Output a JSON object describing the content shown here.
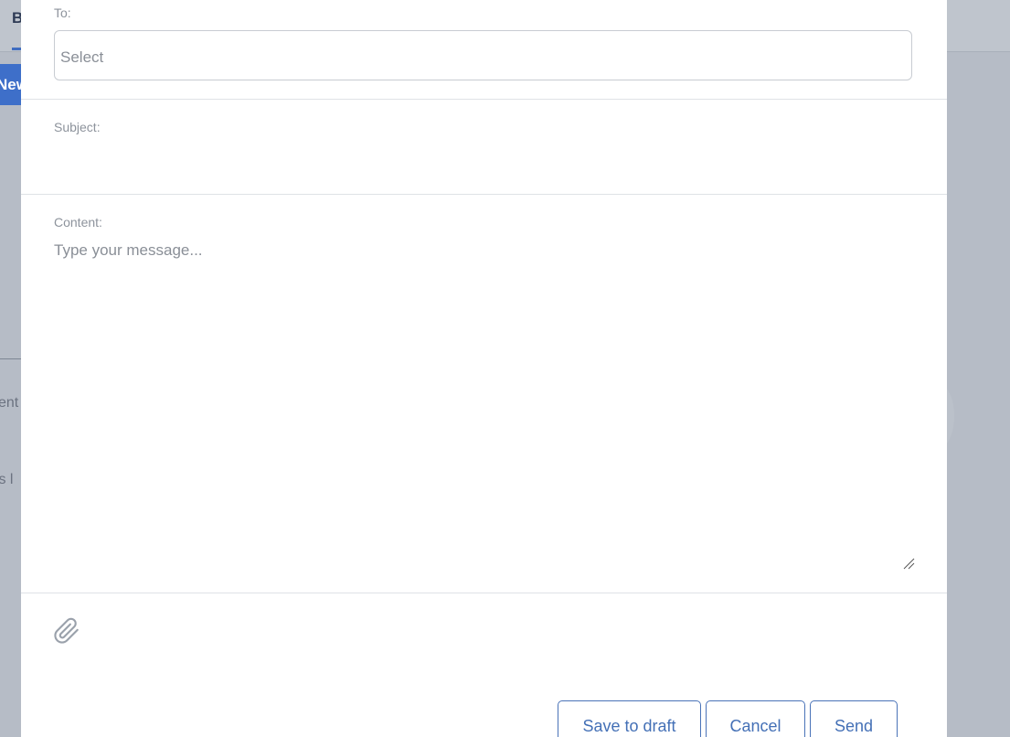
{
  "background": {
    "tab_label": "B",
    "new_button_label": "New",
    "text_line_1": "ent",
    "text_line_2": "ts l"
  },
  "compose": {
    "to_label": "To:",
    "to_placeholder": "Select",
    "subject_label": "Subject:",
    "subject_value": "",
    "content_label": "Content:",
    "content_placeholder": "Type your message...",
    "icons": {
      "attachment": "paperclip-icon",
      "resize": "resize-grip-icon"
    },
    "buttons": {
      "save_draft": "Save to draft",
      "cancel": "Cancel",
      "send": "Send"
    }
  },
  "colors": {
    "accent": "#4470b6",
    "overlay": "#b6bcc6",
    "border": "#c8ccd2",
    "muted_text": "#8d939c"
  }
}
